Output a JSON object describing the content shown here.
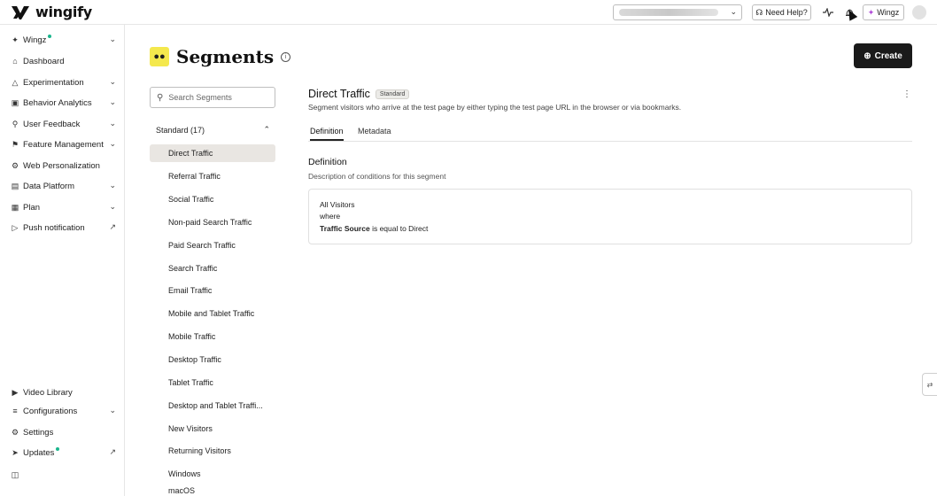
{
  "topbar": {
    "logo_text": "wingify",
    "workspace_select": {
      "value_hidden": true
    },
    "help_label": "Need Help?",
    "wingz_label": "Wingz"
  },
  "sidebar": {
    "items": [
      {
        "label": "Wingz",
        "icon": "sparkle-icon",
        "chevron": true,
        "dot": true
      },
      {
        "label": "Dashboard",
        "icon": "home-icon"
      },
      {
        "label": "Experimentation",
        "icon": "flask-icon",
        "chevron": true
      },
      {
        "label": "Behavior Analytics",
        "icon": "analytics-icon",
        "chevron": true
      },
      {
        "label": "User Feedback",
        "icon": "feedback-icon",
        "chevron": true
      },
      {
        "label": "Feature Management",
        "icon": "flag-icon",
        "chevron": true
      },
      {
        "label": "Web Personalization",
        "icon": "personalization-icon"
      },
      {
        "label": "Data Platform",
        "icon": "database-icon",
        "chevron": true
      },
      {
        "label": "Plan",
        "icon": "calendar-icon",
        "chevron": true
      },
      {
        "label": "Push notification",
        "icon": "push-icon",
        "external": true
      }
    ],
    "bottom_items": [
      {
        "label": "Video Library",
        "icon": "video-icon"
      },
      {
        "label": "Configurations",
        "icon": "sliders-icon",
        "chevron": true
      },
      {
        "label": "Settings",
        "icon": "gear-icon"
      },
      {
        "label": "Updates",
        "icon": "rocket-icon",
        "dot": true,
        "external": true
      }
    ]
  },
  "page": {
    "title": "Segments",
    "create_label": "Create"
  },
  "segments_panel": {
    "search_placeholder": "Search Segments",
    "group_label": "Standard (17)",
    "items": [
      "Direct Traffic",
      "Referral Traffic",
      "Social Traffic",
      "Non-paid Search Traffic",
      "Paid Search Traffic",
      "Search Traffic",
      "Email Traffic",
      "Mobile and Tablet Traffic",
      "Mobile Traffic",
      "Desktop Traffic",
      "Tablet Traffic",
      "Desktop and Tablet Traffi...",
      "New Visitors",
      "Returning Visitors",
      "Windows",
      "macOS"
    ],
    "active_index": 0
  },
  "detail": {
    "name": "Direct Traffic",
    "badge": "Standard",
    "description": "Segment visitors who arrive at the test page by either typing the test page URL in the browser or via bookmarks.",
    "tabs": [
      "Definition",
      "Metadata"
    ],
    "section_title": "Definition",
    "section_subtitle": "Description of conditions for this segment",
    "condition": {
      "audience": "All Visitors",
      "where": "where",
      "field": "Traffic Source",
      "operator_value": "is equal to Direct"
    }
  },
  "colors": {
    "accent_dot": "#19b58c",
    "segment_icon_bg": "#f4e84d",
    "create_bg": "#1a1a1a",
    "active_row_bg": "#e9e6e2"
  }
}
